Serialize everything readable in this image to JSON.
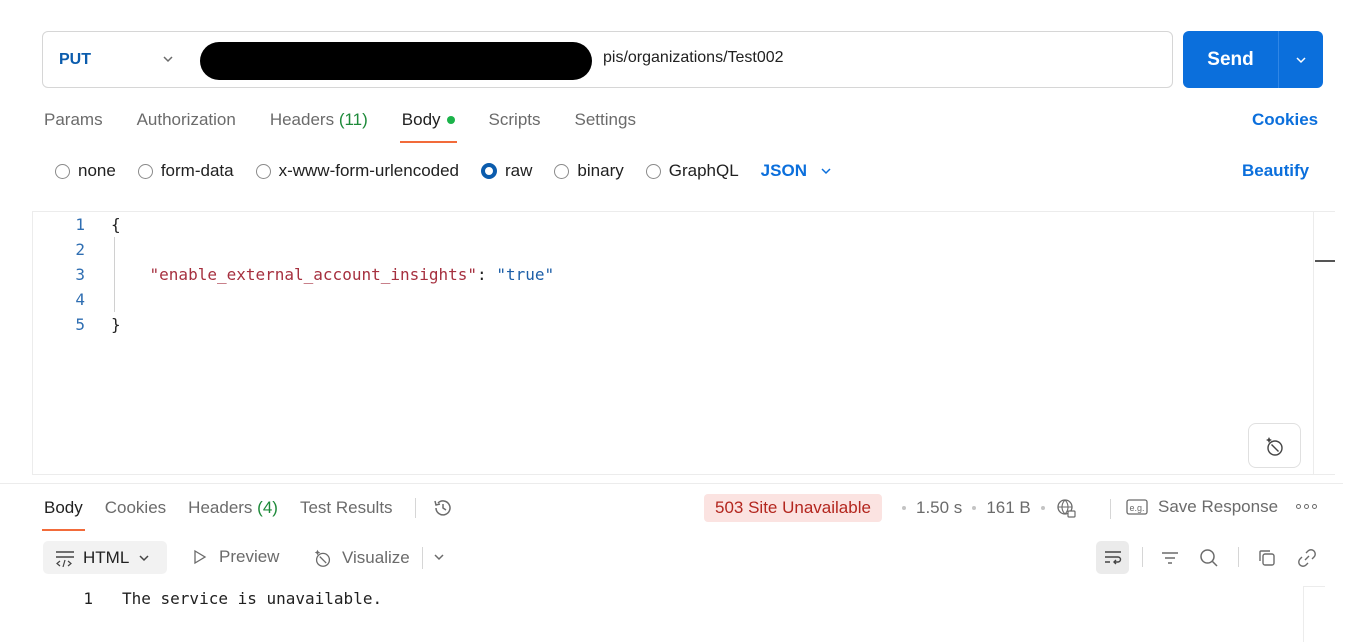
{
  "request": {
    "method": "PUT",
    "url_visible": "pis/organizations/Test002",
    "send_label": "Send"
  },
  "request_tabs": {
    "params": "Params",
    "authorization": "Authorization",
    "headers": "Headers",
    "headers_count": "(11)",
    "body": "Body",
    "scripts": "Scripts",
    "settings": "Settings",
    "cookies": "Cookies"
  },
  "body_types": {
    "none": "none",
    "form_data": "form-data",
    "urlencoded": "x-www-form-urlencoded",
    "raw": "raw",
    "binary": "binary",
    "graphql": "GraphQL",
    "language": "JSON",
    "beautify": "Beautify",
    "selected": "raw"
  },
  "editor": {
    "lines": [
      {
        "num": "1",
        "text": "{"
      },
      {
        "num": "2",
        "text": ""
      },
      {
        "num": "3",
        "key": "\"enable_external_account_insights\"",
        "sep": ": ",
        "value": "\"true\""
      },
      {
        "num": "4",
        "text": ""
      },
      {
        "num": "5",
        "text": "}"
      }
    ]
  },
  "response_tabs": {
    "body": "Body",
    "cookies": "Cookies",
    "headers": "Headers",
    "headers_count": "(4)",
    "test_results": "Test Results"
  },
  "response_meta": {
    "status": "503 Site Unavailable",
    "time": "1.50 s",
    "size": "161 B",
    "save_response": "Save Response"
  },
  "response_toolbar": {
    "format": "HTML",
    "preview": "Preview",
    "visualize": "Visualize"
  },
  "response_body": {
    "line_num": "1",
    "text": "The service is unavailable."
  },
  "colors": {
    "accent_blue": "#0b6fdc",
    "method_blue": "#0b5cad",
    "active_tab_underline": "#f26b3a",
    "status_bg": "#fbe3e1",
    "status_text": "#b3261e",
    "count_green": "#1e8a3a",
    "body_dot": "#1bb34a"
  }
}
